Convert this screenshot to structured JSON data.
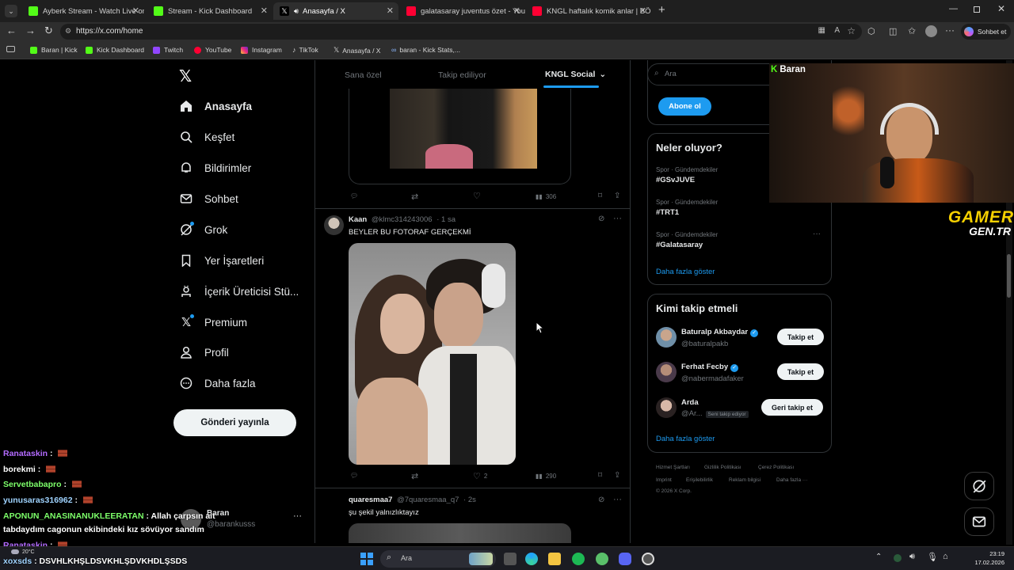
{
  "browser": {
    "tabs": [
      {
        "label": "Ayberk Stream - Watch Live on Ki",
        "color": "#53fc18"
      },
      {
        "label": "Stream - Kick Dashboard",
        "color": "#53fc18"
      },
      {
        "label": "Anasayfa / X",
        "color": "#ffffff"
      },
      {
        "label": "galatasaray juventus özet - YouTub",
        "color": "#ff0033"
      },
      {
        "label": "KNGL haftalık komik anlar | BÖLÜM",
        "color": "#ff0033"
      }
    ],
    "url": "https://x.com/home",
    "profile_label": "Sohbet et",
    "bookmarks": [
      {
        "label": "Baran | Kick",
        "color": "#53fc18"
      },
      {
        "label": "Kick Dashboard",
        "color": "#53fc18"
      },
      {
        "label": "Twitch",
        "color": "#9146ff"
      },
      {
        "label": "YouTube",
        "color": "#ff0033"
      },
      {
        "label": "Instagram",
        "color": "#e1306c"
      },
      {
        "label": "TikTok",
        "color": "#ffffff"
      },
      {
        "label": "Anasayfa / X",
        "color": "#ffffff"
      },
      {
        "label": "baran - Kick Stats,...",
        "color": "#8ab4f8"
      }
    ]
  },
  "x": {
    "nav": [
      {
        "label": "Anasayfa",
        "icon": "home-icon"
      },
      {
        "label": "Keşfet",
        "icon": "search-icon"
      },
      {
        "label": "Bildirimler",
        "icon": "bell-icon"
      },
      {
        "label": "Sohbet",
        "icon": "mail-icon"
      },
      {
        "label": "Grok",
        "icon": "grok-icon"
      },
      {
        "label": "Yer İşaretleri",
        "icon": "bookmark-icon"
      },
      {
        "label": "İçerik Üreticisi Stü...",
        "icon": "creator-icon"
      },
      {
        "label": "Premium",
        "icon": "x-premium-icon"
      },
      {
        "label": "Profil",
        "icon": "person-icon"
      },
      {
        "label": "Daha fazla",
        "icon": "more-circle-icon"
      }
    ],
    "post_button": "Gönderi yayınla",
    "account": {
      "name": "Baran",
      "handle": "@barankusss"
    },
    "feed_tabs": [
      "Sana özel",
      "Takip ediliyor",
      "KNGL Social"
    ],
    "post1": {
      "views": "306"
    },
    "post2": {
      "name": "Kaan",
      "handle": "@klmc314243006",
      "time": "· 1 sa",
      "text": "BEYLER BU FOTORAF GERÇEKMİ",
      "likes": "2",
      "views": "290"
    },
    "post3": {
      "name": "quaresmaa7",
      "handle": "@7quaresmaa_q7",
      "time": "· 2s",
      "text": "şu şekil yalnızlıktayız"
    },
    "search_placeholder": "Ara",
    "subscribe_label": "Abone ol",
    "trends": {
      "title": "Neler oluyor?",
      "items": [
        {
          "meta": "Spor · Gündemdekiler",
          "tag": "#GSvJUVE"
        },
        {
          "meta": "Spor · Gündemdekiler",
          "tag": "#TRT1"
        },
        {
          "meta": "Spor · Gündemdekiler",
          "tag": "#Galatasaray"
        }
      ],
      "more": "Daha fazla göster"
    },
    "who_to_follow": {
      "title": "Kimi takip etmeli",
      "items": [
        {
          "name": "Baturalp Akbaydar",
          "handle": "@baturalpakb",
          "button": "Takip et"
        },
        {
          "name": "Ferhat Fecby",
          "handle": "@nabermadafaker",
          "button": "Takip et"
        },
        {
          "name": "Arda",
          "handle": "@Ar...",
          "badge": "Seni takip ediyor",
          "button": "Geri takip et"
        }
      ],
      "more": "Daha fazla göster"
    },
    "footer": [
      "Hizmet Şartları",
      "Gizlilik Politikası",
      "Çerez Politikası",
      "Imprint",
      "Erişilebilirlik",
      "Reklam bilgisi",
      "Daha fazla ···",
      "© 2026 X Corp."
    ]
  },
  "stream": {
    "cam_label": "Baran",
    "logo_line1": "GAMER",
    "logo_line2": "GEN.TR",
    "chat": [
      {
        "user": "Ranataskin",
        "msg": "",
        "color": "#b36bff",
        "brick": true
      },
      {
        "user": "borekmi",
        "msg": "",
        "color": "#ffffff",
        "brick": true
      },
      {
        "user": "Servetbabapro",
        "msg": "",
        "color": "#7dff6a",
        "brick": true
      },
      {
        "user": "yunusaras316962",
        "msg": "",
        "color": "#9fd3ff",
        "brick": true
      },
      {
        "user": "APONUN_ANASINANUKLEERATAN",
        "msg": "Allah çarpsın ait",
        "color": "#7dff6a",
        "brick": false
      },
      {
        "user": "",
        "msg": "tabdaydım cagonun ekibindeki kız sövüyor sandım",
        "color": "#ffffff",
        "brick": false
      },
      {
        "user": "Ranataskin",
        "msg": "",
        "color": "#b36bff",
        "brick": true
      },
      {
        "user": "xoxsds",
        "msg": "DSVHLKHŞLDSVKHLŞDVKHDLŞSDS",
        "color": "#9fd3ff",
        "brick": false
      }
    ]
  },
  "taskbar": {
    "weather": "20°C",
    "search": "Ara",
    "time": "23:19",
    "date": "17.02.2026"
  }
}
